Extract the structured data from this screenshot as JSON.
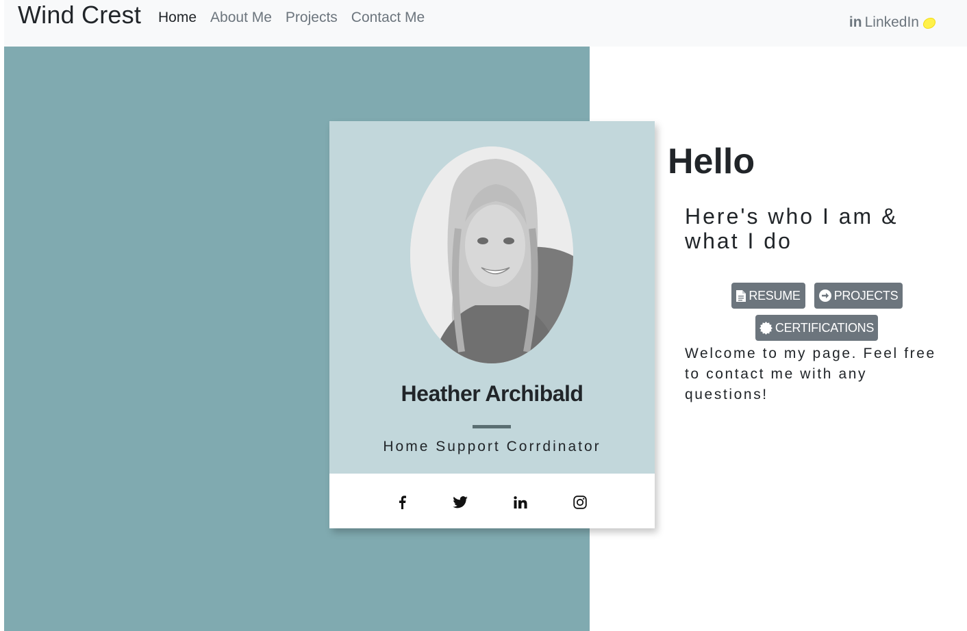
{
  "navbar": {
    "brand": "Wind Crest",
    "links": [
      {
        "label": "Home",
        "active": true
      },
      {
        "label": "About Me",
        "active": false
      },
      {
        "label": "Projects",
        "active": false
      },
      {
        "label": "Contact Me",
        "active": false
      }
    ],
    "linkedin": {
      "glyph": "in",
      "label": "LinkedIn",
      "icon": "lemon-icon"
    }
  },
  "profile_card": {
    "photo": "profile-photo",
    "name": "Heather Archibald",
    "role": "Home Support Corrdinator",
    "socials": [
      "facebook-icon",
      "twitter-icon",
      "linkedin-icon",
      "instagram-icon"
    ]
  },
  "intro": {
    "heading": "Hello",
    "tagline": "Here's who I am & what I do",
    "buttons": [
      {
        "label": "RESUME",
        "icon": "file-icon"
      },
      {
        "label": "PROJECTS",
        "icon": "arrow-circle-icon"
      },
      {
        "label": "CERTIFICATIONS",
        "icon": "certificate-icon"
      }
    ],
    "welcome": "Welcome to my page. Feel free to contact me with any questions!"
  },
  "colors": {
    "navbar_bg": "#f8f9fa",
    "teal_panel": "#80aab0",
    "card_top": "#c2d7db",
    "button_bg": "#6c757d",
    "divider": "#5a6e72"
  }
}
